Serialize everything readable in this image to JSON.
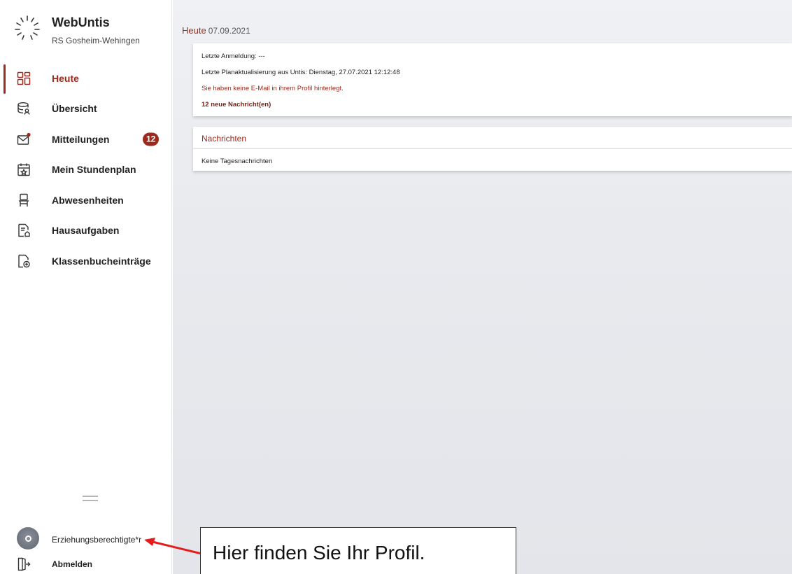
{
  "app": {
    "name": "WebUntis",
    "school": "RS Gosheim-Wehingen"
  },
  "colors": {
    "accent": "#9b2a1e",
    "main_background": "#eceef1",
    "sidebar_background": "#ffffff"
  },
  "sidebar": {
    "items": [
      {
        "label": "Heute",
        "icon": "dashboard-icon",
        "active": true
      },
      {
        "label": "Übersicht",
        "icon": "overview-icon"
      },
      {
        "label": "Mitteilungen",
        "icon": "mail-icon",
        "badge": "12"
      },
      {
        "label": "Mein Stundenplan",
        "icon": "calendar-icon"
      },
      {
        "label": "Abwesenheiten",
        "icon": "chair-icon"
      },
      {
        "label": "Hausaufgaben",
        "icon": "homework-icon"
      },
      {
        "label": "Klassenbucheinträge",
        "icon": "classbook-icon"
      }
    ],
    "profile": {
      "label": "Erziehungsberechtigte*r",
      "icon": "avatar-icon"
    },
    "logout": {
      "label": "Abmelden",
      "icon": "logout-icon"
    }
  },
  "main": {
    "heading": "Heute",
    "date": "07.09.2021",
    "info_card": {
      "last_login": "Letzte Anmeldung: ---",
      "last_update": "Letzte Planaktualisierung aus Untis: Dienstag, 27.07.2021 12:12:48",
      "email_warning": "Sie haben keine E-Mail in ihrem Profil hinterlegt.",
      "new_messages": "12 neue Nachricht(en)"
    },
    "news_card": {
      "title": "Nachrichten",
      "empty_text": "Keine Tagesnachrichten"
    }
  },
  "annotation": {
    "text": "Hier finden Sie Ihr Profil."
  }
}
